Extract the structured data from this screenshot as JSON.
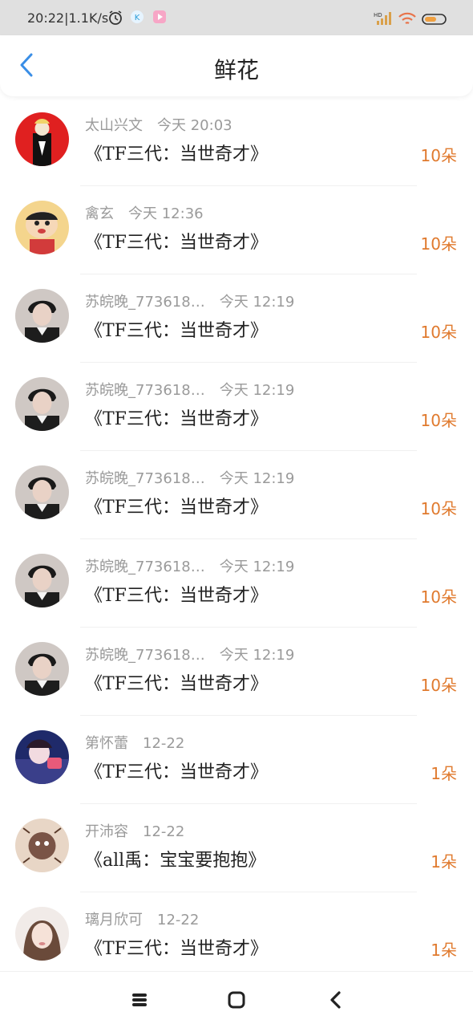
{
  "status_bar": {
    "time": "20:22",
    "speed": "1.1K/s",
    "icons": [
      "alarm-icon",
      "app-k-icon",
      "app-play-icon",
      "hd-icon",
      "signal-icon",
      "wifi-icon",
      "battery-icon"
    ]
  },
  "header": {
    "title": "鲜花",
    "back_icon": "chevron-left-icon",
    "accent": "#3a8ee6"
  },
  "list": {
    "items": [
      {
        "user": "太山兴文",
        "time": "今天 20:03",
        "book": "《TF三代：当世奇才》",
        "count": "10朵",
        "avatar": "a1"
      },
      {
        "user": "禽玄",
        "time": "今天 12:36",
        "book": "《TF三代：当世奇才》",
        "count": "10朵",
        "avatar": "a2"
      },
      {
        "user": "苏皖晚_773618…",
        "time": "今天 12:19",
        "book": "《TF三代：当世奇才》",
        "count": "10朵",
        "avatar": "a3"
      },
      {
        "user": "苏皖晚_773618…",
        "time": "今天 12:19",
        "book": "《TF三代：当世奇才》",
        "count": "10朵",
        "avatar": "a3"
      },
      {
        "user": "苏皖晚_773618…",
        "time": "今天 12:19",
        "book": "《TF三代：当世奇才》",
        "count": "10朵",
        "avatar": "a3"
      },
      {
        "user": "苏皖晚_773618…",
        "time": "今天 12:19",
        "book": "《TF三代：当世奇才》",
        "count": "10朵",
        "avatar": "a3"
      },
      {
        "user": "苏皖晚_773618…",
        "time": "今天 12:19",
        "book": "《TF三代：当世奇才》",
        "count": "10朵",
        "avatar": "a3"
      },
      {
        "user": "第怀蕾",
        "time": "12-22",
        "book": "《TF三代：当世奇才》",
        "count": "1朵",
        "avatar": "a4"
      },
      {
        "user": "开沛容",
        "time": "12-22",
        "book": "《all禹：宝宝要抱抱》",
        "count": "1朵",
        "avatar": "a5"
      },
      {
        "user": "璃月欣可",
        "time": "12-22",
        "book": "《TF三代：当世奇才》",
        "count": "1朵",
        "avatar": "a6"
      }
    ]
  },
  "colors": {
    "count": "#e07a2e",
    "meta": "#9a9a9a"
  },
  "nav_bar": {
    "icons": [
      "menu-icon",
      "home-icon",
      "back-icon"
    ]
  }
}
